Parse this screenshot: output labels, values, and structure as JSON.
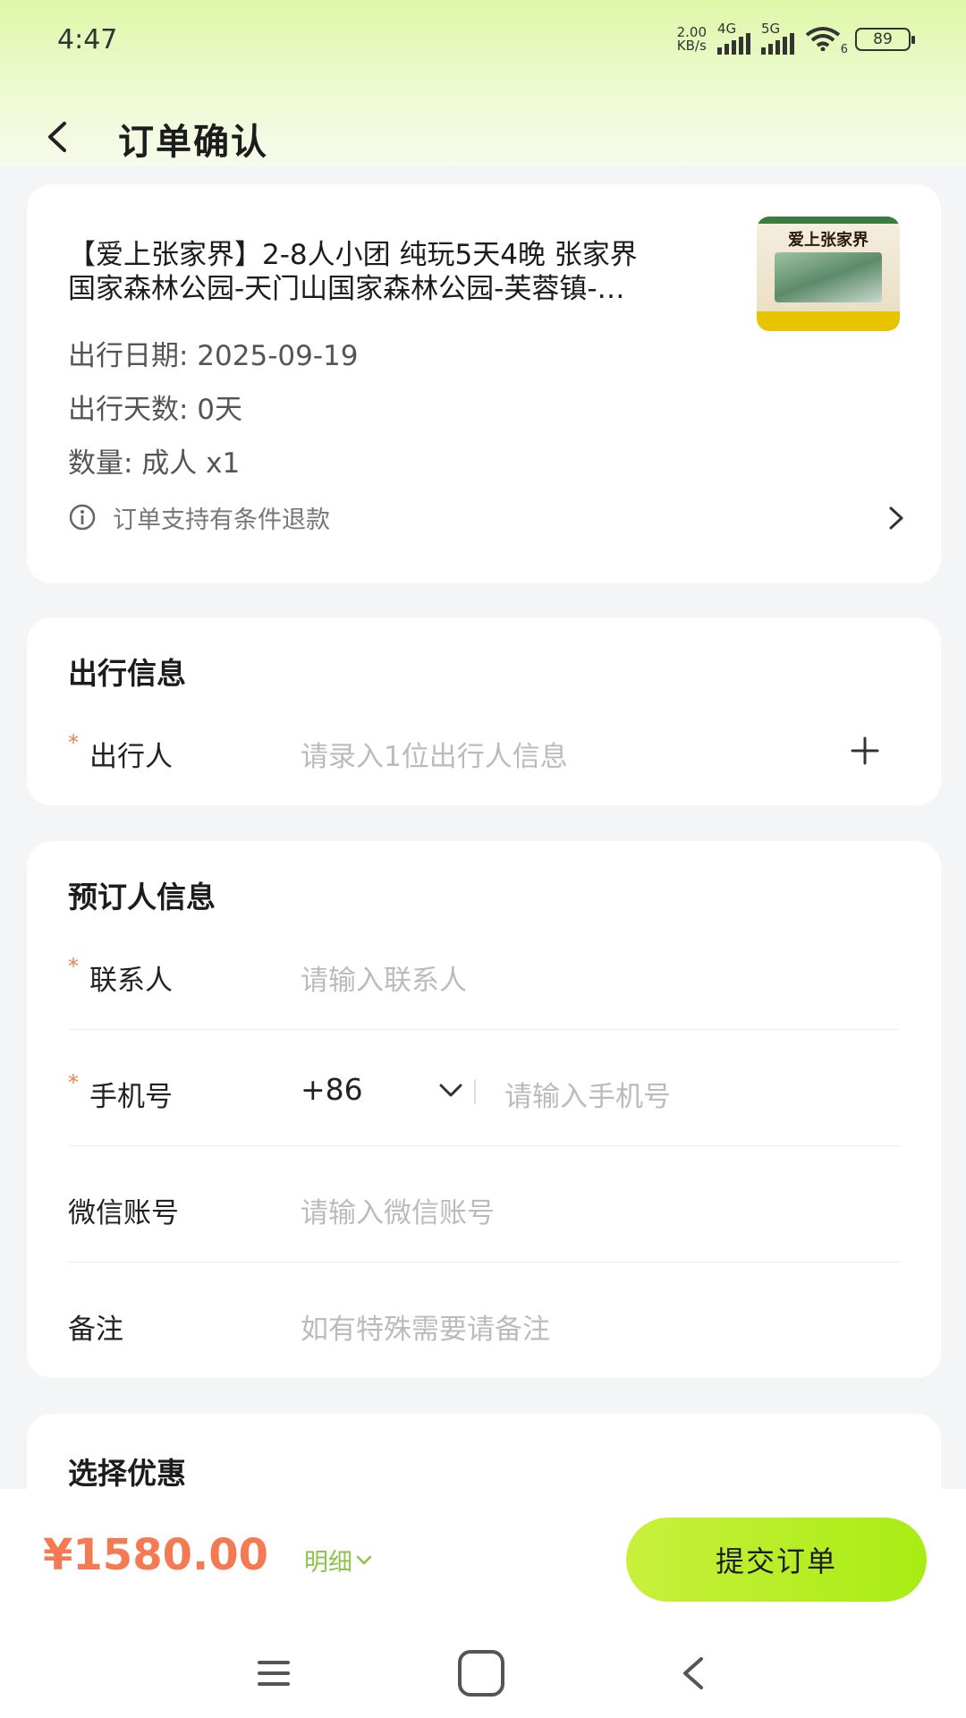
{
  "status_bar": {
    "time": "4:47",
    "net_speed_value": "2.00",
    "net_speed_unit": "KB/s",
    "signal1_label": "4G",
    "signal2_label": "5G",
    "wifi_level": "6",
    "battery": "89"
  },
  "header": {
    "title": "订单确认"
  },
  "product": {
    "title_line1": "【爱上张家界】2-8人小团 纯玩5天4晚 张家界",
    "title_line2": "国家森林公园-天门山国家森林公园-芙蓉镇-…",
    "thumb_text": "爱上张家界",
    "date_line": "出行日期: 2025-09-19",
    "days_line": "出行天数: 0天",
    "qty_line": "数量: 成人 x1",
    "refund_note": "订单支持有条件退款"
  },
  "travel_info": {
    "title": "出行信息",
    "required_mark": "*",
    "traveler_label": "出行人",
    "traveler_placeholder": "请录入1位出行人信息"
  },
  "booker_info": {
    "title": "预订人信息",
    "required_mark": "*",
    "contact_label": "联系人",
    "contact_placeholder": "请输入联系人",
    "phone_label": "手机号",
    "country_code": "+86",
    "phone_placeholder": "请输入手机号",
    "wechat_label": "微信账号",
    "wechat_placeholder": "请输入微信账号",
    "remark_label": "备注",
    "remark_placeholder": "如有特殊需要请备注"
  },
  "discount": {
    "title": "选择优惠"
  },
  "footer": {
    "price": "¥1580.00",
    "detail_label": "明细",
    "submit_label": "提交订单"
  },
  "colors": {
    "accent_green": "#a8ec14",
    "price_orange": "#f37a52",
    "required_orange": "#f08050"
  }
}
